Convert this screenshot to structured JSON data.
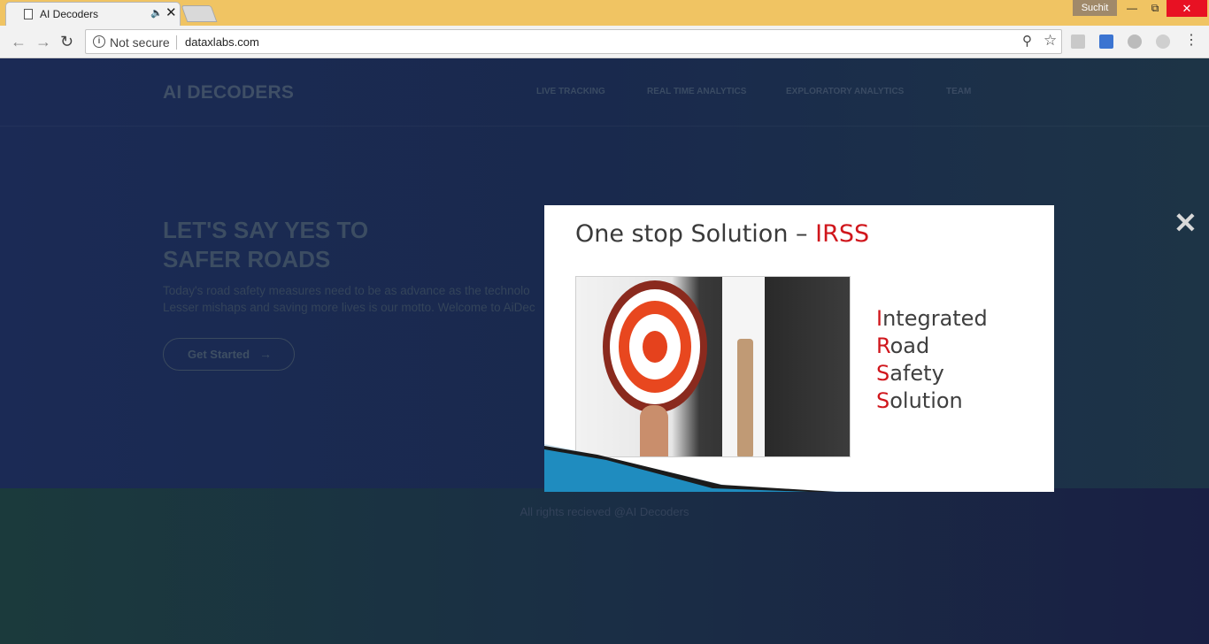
{
  "browser": {
    "tab_title": "AI Decoders",
    "profile_name": "Suchit",
    "security_label": "Not secure",
    "url": "dataxlabs.com"
  },
  "site": {
    "brand": "AI DECODERS",
    "nav": {
      "live_tracking": "LIVE TRACKING",
      "real_time_analytics": "REAL TIME ANALYTICS",
      "exploratory_analytics": "EXPLORATORY ANALYTICS",
      "team": "TEAM"
    },
    "hero": {
      "heading_line1": "LET'S SAY YES TO",
      "heading_line2": "SAFER ROADS",
      "text_line1": "Today's road safety measures need to be as advance as the technolo",
      "text_line2": "Lesser mishaps and saving more lives is our motto. Welcome to AiDec",
      "button_label": "Get Started"
    },
    "footer_text": "All rights recieved @AI Decoders"
  },
  "lightbox": {
    "title_main": "One stop Solution  –",
    "title_accent": "IRSS",
    "acronym": [
      {
        "initial": "I",
        "rest": "ntegrated"
      },
      {
        "initial": "R",
        "rest": "oad"
      },
      {
        "initial": "S",
        "rest": "afety"
      },
      {
        "initial": "S",
        "rest": "olution"
      }
    ]
  },
  "colors": {
    "accent_red": "#d0161c",
    "titlebar": "#f0c463",
    "page_bg": "#1b2a55"
  }
}
